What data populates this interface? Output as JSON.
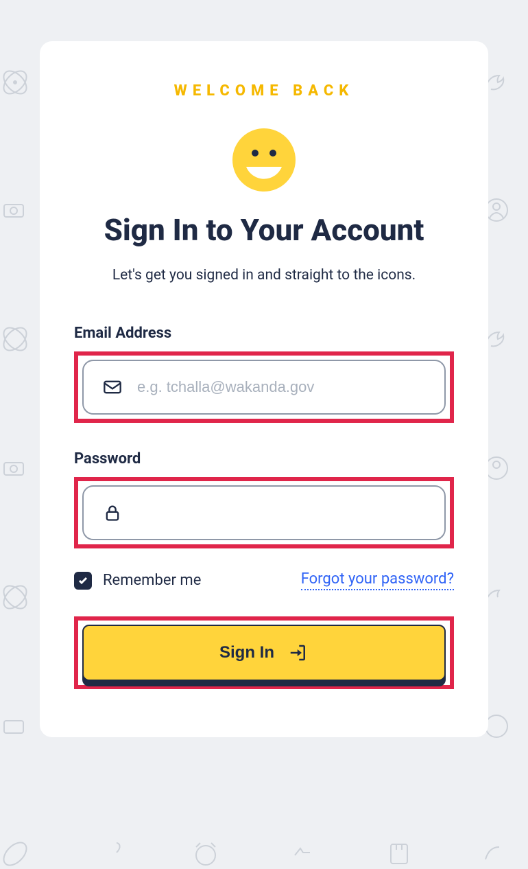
{
  "welcome": "WELCOME BACK",
  "title": "Sign In to Your Account",
  "subtitle": "Let's get you signed in and straight to the icons.",
  "email": {
    "label": "Email Address",
    "placeholder": "e.g. tchalla@wakanda.gov",
    "value": ""
  },
  "password": {
    "label": "Password",
    "value": ""
  },
  "remember": {
    "label": "Remember me",
    "checked": true
  },
  "forgot": "Forgot your password?",
  "signin": "Sign In"
}
